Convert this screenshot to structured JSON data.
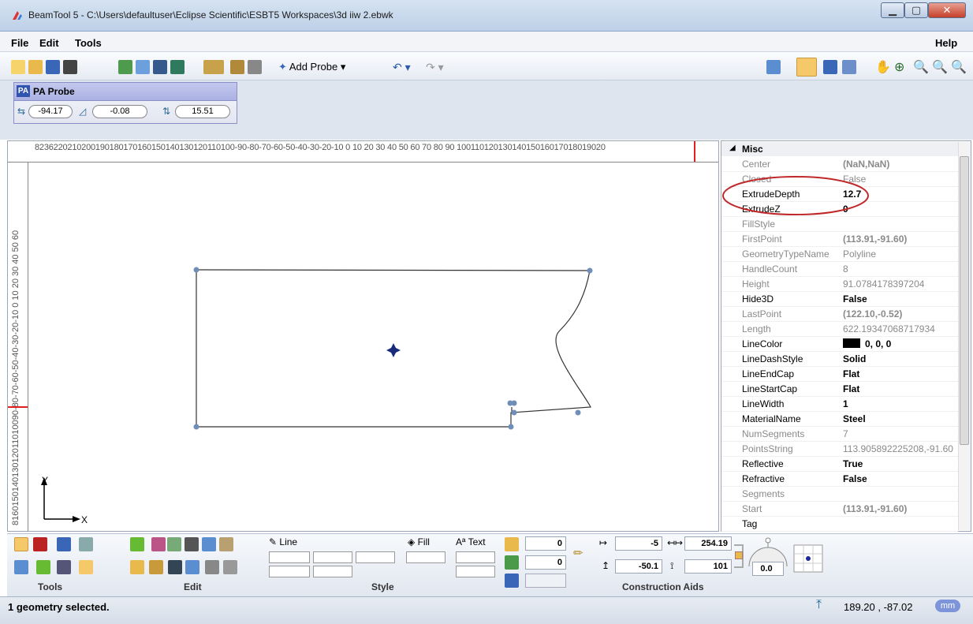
{
  "window": {
    "title": "BeamTool 5 - C:\\Users\\defaultuser\\Eclipse Scientific\\ESBT5 Workspaces\\3d iiw 2.ebwk"
  },
  "menu": {
    "file": "File",
    "edit": "Edit",
    "tools": "Tools",
    "help": "Help"
  },
  "toolbar": {
    "add_probe": "Add Probe"
  },
  "probe": {
    "title": "PA Probe",
    "badge": "PA",
    "x": "-94.17",
    "angle": "-0.08",
    "z": "15.51"
  },
  "rulers": {
    "top": "8236220210200190180170160150140130120110100-90-80-70-60-50-40-30-20-10  0   10  20  30  40  50  60  70  80  90 10011012013014015016017018019020",
    "left": "816015014013012011010090-80-70-60-50-40-30-20-10  0  10  20  30  40  50  60"
  },
  "axes": {
    "y": "Y",
    "x": "X"
  },
  "properties": {
    "section": "Misc",
    "rows": [
      {
        "name": "Center",
        "value": "(NaN,NaN)",
        "bold": true,
        "muted": true
      },
      {
        "name": "Closed",
        "value": "False",
        "bold": false,
        "muted": true
      },
      {
        "name": "ExtrudeDepth",
        "value": "12.7",
        "bold": true,
        "muted": false
      },
      {
        "name": "ExtrudeZ",
        "value": "0",
        "bold": true,
        "muted": false
      },
      {
        "name": "FillStyle",
        "value": "",
        "bold": false,
        "muted": true
      },
      {
        "name": "FirstPoint",
        "value": "(113.91,-91.60)",
        "bold": true,
        "muted": true
      },
      {
        "name": "GeometryTypeName",
        "value": "Polyline",
        "bold": false,
        "muted": true
      },
      {
        "name": "HandleCount",
        "value": "8",
        "bold": false,
        "muted": true
      },
      {
        "name": "Height",
        "value": "91.0784178397204",
        "bold": false,
        "muted": true
      },
      {
        "name": "Hide3D",
        "value": "False",
        "bold": true,
        "muted": false
      },
      {
        "name": "LastPoint",
        "value": "(122.10,-0.52)",
        "bold": true,
        "muted": true
      },
      {
        "name": "Length",
        "value": "622.19347068717934",
        "bold": false,
        "muted": true
      },
      {
        "name": "LineColor",
        "value": "0, 0, 0",
        "bold": true,
        "muted": false
      },
      {
        "name": "LineDashStyle",
        "value": "Solid",
        "bold": true,
        "muted": false
      },
      {
        "name": "LineEndCap",
        "value": "Flat",
        "bold": true,
        "muted": false
      },
      {
        "name": "LineStartCap",
        "value": "Flat",
        "bold": true,
        "muted": false
      },
      {
        "name": "LineWidth",
        "value": "1",
        "bold": true,
        "muted": false
      },
      {
        "name": "MaterialName",
        "value": "Steel",
        "bold": true,
        "muted": false
      },
      {
        "name": "NumSegments",
        "value": "7",
        "bold": false,
        "muted": true
      },
      {
        "name": "PointsString",
        "value": "113.905892225208,-91.60",
        "bold": false,
        "muted": true
      },
      {
        "name": "Reflective",
        "value": "True",
        "bold": true,
        "muted": false
      },
      {
        "name": "Refractive",
        "value": "False",
        "bold": true,
        "muted": false
      },
      {
        "name": "Segments",
        "value": "",
        "bold": false,
        "muted": true
      },
      {
        "name": "Start",
        "value": "(113.91,-91.60)",
        "bold": true,
        "muted": true
      },
      {
        "name": "Tag",
        "value": "",
        "bold": false,
        "muted": false
      }
    ]
  },
  "ribbon": {
    "groups": {
      "tools": "Tools",
      "edit": "Edit",
      "style": "Style",
      "construction": "Construction Aids"
    },
    "style": {
      "line": "Line",
      "fill": "Fill",
      "text": "Text"
    },
    "inputs": {
      "text_a": "0",
      "text_b": "0",
      "offset_x": "-5",
      "width": "254.19",
      "offset_y": "-50.1",
      "height": "101",
      "angle": "0.0"
    }
  },
  "status": {
    "message": "1 geometry selected.",
    "coords": "189.20 , -87.02",
    "units": "mm"
  },
  "colors": {
    "highlight_ellipse": "#c0282a",
    "ruler_marker": "#e02020",
    "handle": "#6f8fb8"
  }
}
